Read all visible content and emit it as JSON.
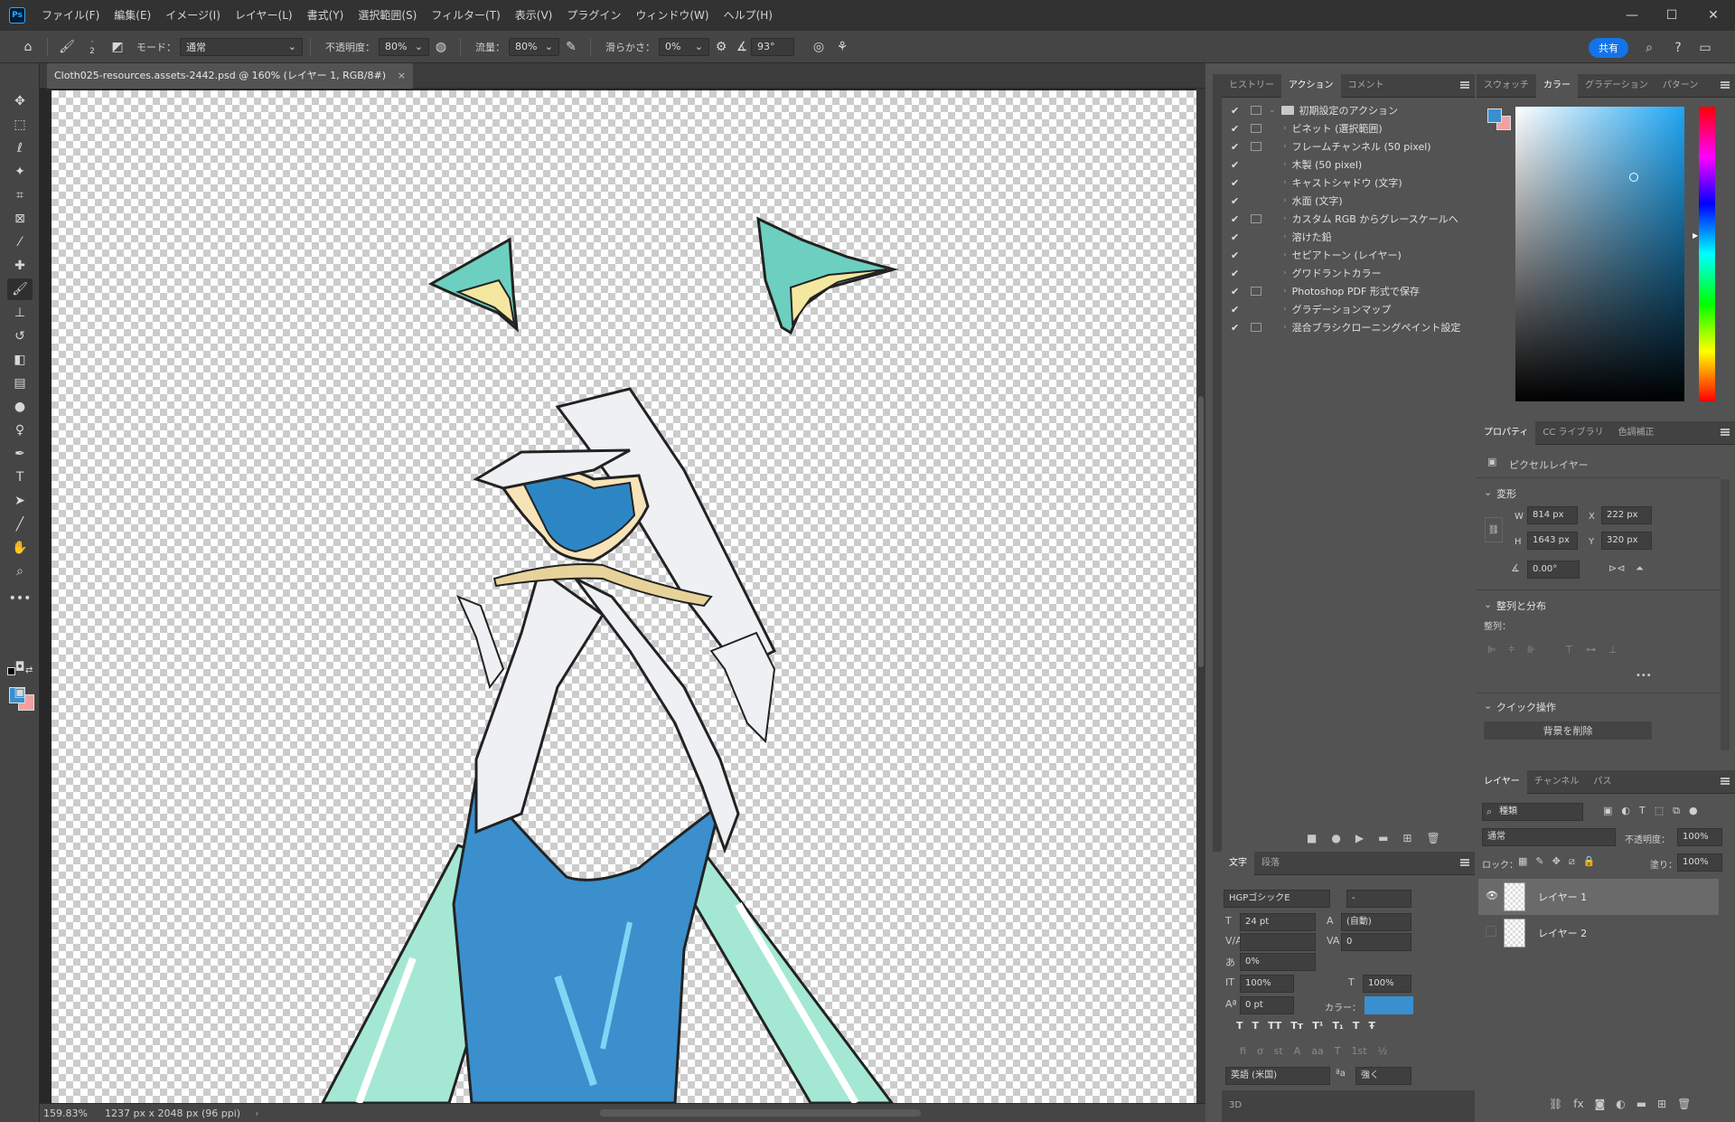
{
  "menubar": {
    "app_logo": "Ps",
    "items": [
      "ファイル(F)",
      "編集(E)",
      "イメージ(I)",
      "レイヤー(L)",
      "書式(Y)",
      "選択範囲(S)",
      "フィルター(T)",
      "表示(V)",
      "プラグイン",
      "ウィンドウ(W)",
      "ヘルプ(H)"
    ]
  },
  "options": {
    "brush_size": "2",
    "mode_label": "モード：",
    "mode_value": "通常",
    "opacity_label": "不透明度：",
    "opacity_value": "80%",
    "flow_label": "流量：",
    "flow_value": "80%",
    "smoothing_label": "滑らかさ：",
    "smoothing_value": "0%",
    "angle_value": "93°",
    "share_label": "共有"
  },
  "document": {
    "tab_title": "Cloth025-resources.assets-2442.psd @ 160% (レイヤー 1, RGB/8#)",
    "close_glyph": "×",
    "zoom": "159.83%",
    "doc_info": "1237 px x 2048 px (96 ppi)"
  },
  "actions_panel": {
    "tabs": [
      "ヒストリー",
      "アクション",
      "コメント"
    ],
    "active_tab": "アクション",
    "set_name": "初期設定のアクション",
    "items": [
      {
        "label": "ビネット (選択範囲)",
        "dialog": true
      },
      {
        "label": "フレームチャンネル (50 pixel)",
        "dialog": true
      },
      {
        "label": "木製 (50 pixel)",
        "dialog": false
      },
      {
        "label": "キャストシャドウ (文字)",
        "dialog": false
      },
      {
        "label": "水面 (文字)",
        "dialog": false
      },
      {
        "label": "カスタム RGB からグレースケールへ",
        "dialog": true
      },
      {
        "label": "溶けた鉛",
        "dialog": false
      },
      {
        "label": "セピアトーン (レイヤー)",
        "dialog": false
      },
      {
        "label": "グワドラントカラー",
        "dialog": false
      },
      {
        "label": "Photoshop PDF 形式で保存",
        "dialog": true
      },
      {
        "label": "グラデーションマップ",
        "dialog": false
      },
      {
        "label": "混合ブラシクローニングペイント設定",
        "dialog": true
      }
    ]
  },
  "color_panel": {
    "tabs": [
      "スウォッチ",
      "カラー",
      "グラデーション",
      "パターン"
    ],
    "active_tab": "カラー",
    "foreground": "#3a8fd0",
    "background": "#f2a0a0"
  },
  "properties_panel": {
    "tabs": [
      "プロパティ",
      "CC ライブラリ",
      "色調補正"
    ],
    "active_tab": "プロパティ",
    "layer_type": "ピクセルレイヤー",
    "transform_title": "変形",
    "w_label": "W",
    "w_value": "814 px",
    "h_label": "H",
    "h_value": "1643 px",
    "x_label": "X",
    "x_value": "222 px",
    "y_label": "Y",
    "y_value": "320 px",
    "angle_value": "0.00°",
    "align_title": "整列と分布",
    "align_label": "整列：",
    "more": "•••",
    "quick_title": "クイック操作",
    "remove_bg_label": "背景を削除"
  },
  "character_panel": {
    "tabs": [
      "文字",
      "段落"
    ],
    "active_tab": "文字",
    "font_family": "HGPゴシックE",
    "font_style": "-",
    "font_size": "24 pt",
    "leading": "(自動)",
    "kerning": "",
    "tracking": "0",
    "tsume": "0%",
    "vscale": "100%",
    "hscale": "100%",
    "baseline": "0 pt",
    "color_label": "カラー：",
    "text_color": "#3a8fd0",
    "language": "英語 (米国)",
    "aa_label": "ªa",
    "antialias": "強く",
    "threed_tab": "3D"
  },
  "layers_panel": {
    "tabs": [
      "レイヤー",
      "チャンネル",
      "パス"
    ],
    "active_tab": "レイヤー",
    "filter_kind": "種類",
    "blend_mode": "通常",
    "opacity_label": "不透明度：",
    "opacity_value": "100%",
    "lock_label": "ロック：",
    "fill_label": "塗り：",
    "fill_value": "100%",
    "layers": [
      {
        "name": "レイヤー 1",
        "visible": true,
        "selected": true
      },
      {
        "name": "レイヤー 2",
        "visible": false,
        "selected": false
      }
    ]
  }
}
